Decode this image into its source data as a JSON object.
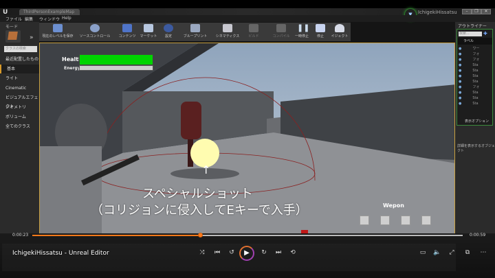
{
  "editor": {
    "tab_title": "ThirdPersonExampleMap",
    "user": "IchigekiHissatsu",
    "menu": [
      "ファイル",
      "編集",
      "ウィンドウ",
      "Help"
    ],
    "modes_label": "モード",
    "class_search_placeholder": "クラスの検索",
    "categories": [
      "最近配置したもの",
      "基本",
      "ライト",
      "Cinematic",
      "ビジュアルエフェクト",
      "ジオメトリ",
      "ボリューム",
      "全てのクラス"
    ],
    "toolbar": [
      "現在のレベルを保存",
      "ソースコントロール",
      "コンテンツ",
      "マーケット",
      "設定",
      "ブループリント",
      "シネマティクス",
      "ビルド",
      "コンパイル",
      "一時停止",
      "停止",
      "イジェクト"
    ],
    "outliner": {
      "title": "アウトライナー",
      "search_placeholder": "検索...",
      "label_header": "ラベル",
      "rows": [
        "ワー",
        "フォ",
        "フォ",
        "Sta",
        "Sta",
        "Sta",
        "Sta",
        "フォ",
        "Sta",
        "Sta",
        "Sta"
      ],
      "view_options": "表示オプション"
    },
    "details_hint": "詳細を表示するオブジェクト"
  },
  "game_hud": {
    "health_label": "Health",
    "health_fraction": 1.0,
    "energy_label": "Energy",
    "energy_fraction": 0.0,
    "caption_arrow": "↑",
    "caption_line1": "スペシャルショット",
    "caption_line2": "（コリジョンに侵入してEキーで入手）",
    "wepon_label": "Wepon",
    "slots": 4,
    "colors": {
      "health": "#00d400",
      "accent": "#ff7a1a"
    }
  },
  "player": {
    "video_title": "IchigekiHissatsu - Unreal Editor",
    "time_current": "0:00:23",
    "time_total": "0:00:59",
    "progress": 0.39
  }
}
